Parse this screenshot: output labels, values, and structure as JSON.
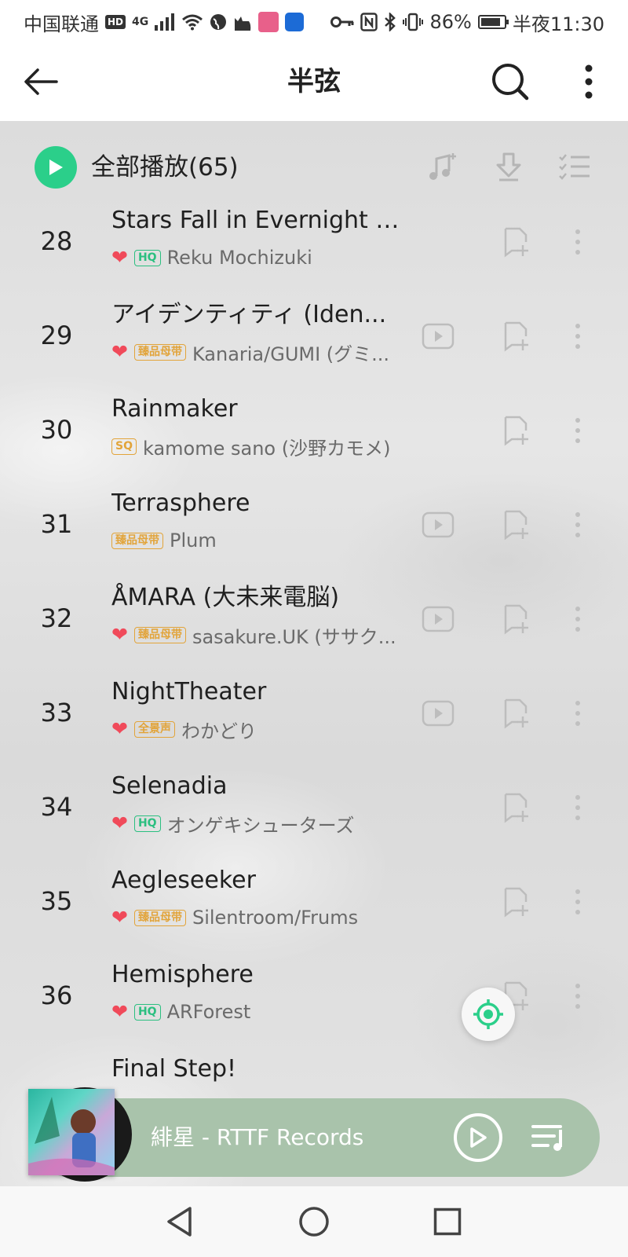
{
  "status_bar": {
    "carrier": "中国联通",
    "hd": "HD",
    "network": "4G",
    "battery": "86%",
    "time": "半夜11:30"
  },
  "header": {
    "title": "半弦"
  },
  "toolbar": {
    "play_all": "全部播放(65)"
  },
  "songs": [
    {
      "num": "28",
      "title": "Stars Fall in Evernight City",
      "heart": true,
      "badge": "HQ",
      "badge_type": "hq",
      "artist": "Reku Mochizuki",
      "mv": false
    },
    {
      "num": "29",
      "title": "アイデンティティ (Iden...",
      "heart": true,
      "badge": "臻品母带",
      "badge_type": "gold",
      "artist": "Kanaria/GUMI (グミ...",
      "mv": true
    },
    {
      "num": "30",
      "title": "Rainmaker",
      "heart": false,
      "badge": "SQ",
      "badge_type": "gold",
      "artist": "kamome sano (沙野カモメ)",
      "mv": false
    },
    {
      "num": "31",
      "title": "Terrasphere",
      "heart": false,
      "badge": "臻品母带",
      "badge_type": "gold",
      "artist": "Plum",
      "mv": true
    },
    {
      "num": "32",
      "title": "ÅMARA (大未来電脳)",
      "heart": true,
      "badge": "臻品母带",
      "badge_type": "gold",
      "artist": "sasakure.UK (ササク...",
      "mv": true
    },
    {
      "num": "33",
      "title": "NightTheater",
      "heart": true,
      "badge": "全景声",
      "badge_type": "gold",
      "artist": "わかどり",
      "mv": true
    },
    {
      "num": "34",
      "title": "Selenadia",
      "heart": true,
      "badge": "HQ",
      "badge_type": "hq",
      "artist": "オンゲキシューターズ",
      "mv": false
    },
    {
      "num": "35",
      "title": "Aegleseeker",
      "heart": true,
      "badge": "臻品母带",
      "badge_type": "gold",
      "artist": "Silentroom/Frums",
      "mv": false
    },
    {
      "num": "36",
      "title": "Hemisphere",
      "heart": true,
      "badge": "HQ",
      "badge_type": "hq",
      "artist": "ARForest",
      "mv": false
    },
    {
      "num": "",
      "title": "Final Step!",
      "heart": false,
      "badge": "",
      "badge_type": "hq",
      "artist": "",
      "mv": false
    }
  ],
  "player": {
    "now_playing": "緋星 - RTTF Records"
  },
  "icons": {
    "back": "arrow-left-icon",
    "search": "search-icon",
    "more": "more-vertical-icon",
    "play_all": "play-circle-icon",
    "add_music": "music-note-add-icon",
    "download": "download-icon",
    "multi_select": "checklist-icon",
    "mv": "video-play-icon",
    "add_to_playlist": "bookmark-add-icon",
    "locate": "locate-icon",
    "queue": "playlist-icon"
  },
  "colors": {
    "accent": "#2bcf8a",
    "heart": "#f04a5a",
    "hq_badge": "#2bbf80",
    "gold_badge": "#e2a43a",
    "player_bar": "#a9c3ab"
  }
}
